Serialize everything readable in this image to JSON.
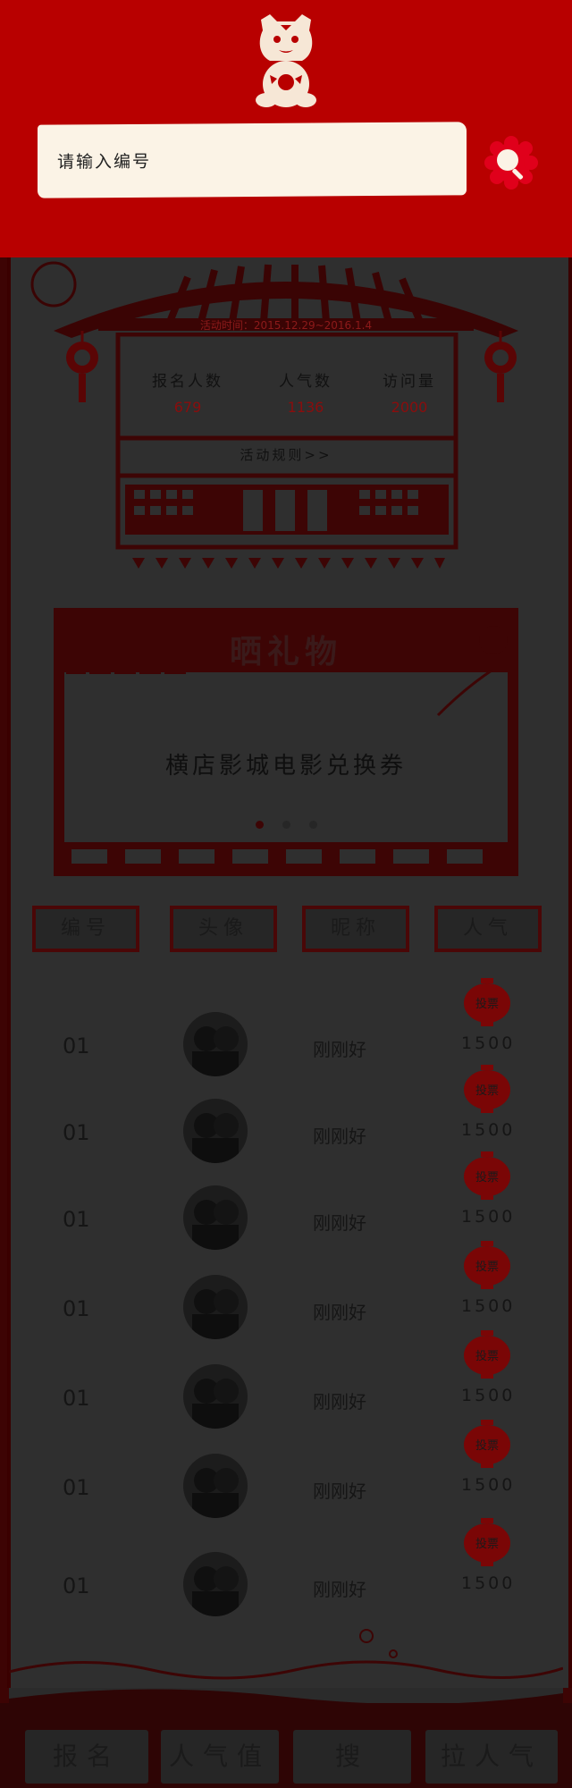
{
  "search": {
    "placeholder": "请输入编号"
  },
  "activity": {
    "date_label": "活动时间：2015.12.29~2016.1.4",
    "stats": [
      {
        "label": "报名人数",
        "value": "679"
      },
      {
        "label": "人气数",
        "value": "1136"
      },
      {
        "label": "访问量",
        "value": "2000"
      }
    ],
    "rules_link": "活动规则>>"
  },
  "gift": {
    "title": "晒礼物",
    "text": "横店影城电影兑换券",
    "dots": 3,
    "active_dot": 0
  },
  "table": {
    "headers": [
      "编号",
      "头像",
      "昵称",
      "人气"
    ],
    "vote_label": "投票",
    "rows": [
      {
        "num": "01",
        "nick": "刚刚好",
        "pop": "1500"
      },
      {
        "num": "01",
        "nick": "刚刚好",
        "pop": "1500"
      },
      {
        "num": "01",
        "nick": "刚刚好",
        "pop": "1500"
      },
      {
        "num": "01",
        "nick": "刚刚好",
        "pop": "1500"
      },
      {
        "num": "01",
        "nick": "刚刚好",
        "pop": "1500"
      },
      {
        "num": "01",
        "nick": "刚刚好",
        "pop": "1500"
      },
      {
        "num": "01",
        "nick": "刚刚好",
        "pop": "1500"
      }
    ]
  },
  "footer": {
    "buttons": [
      "报名",
      "人气值",
      "搜",
      "拉人气"
    ]
  },
  "colors": {
    "header_red": "#b80000",
    "panel_dark": "#2f2f2f",
    "accent_dark_red": "#4a0707",
    "lantern_red": "#7a0606"
  },
  "icons": {
    "mascot": "tiger-paper-cut-icon",
    "search": "search-icon",
    "lantern": "lantern-icon",
    "vote": "lantern-vote-icon"
  }
}
